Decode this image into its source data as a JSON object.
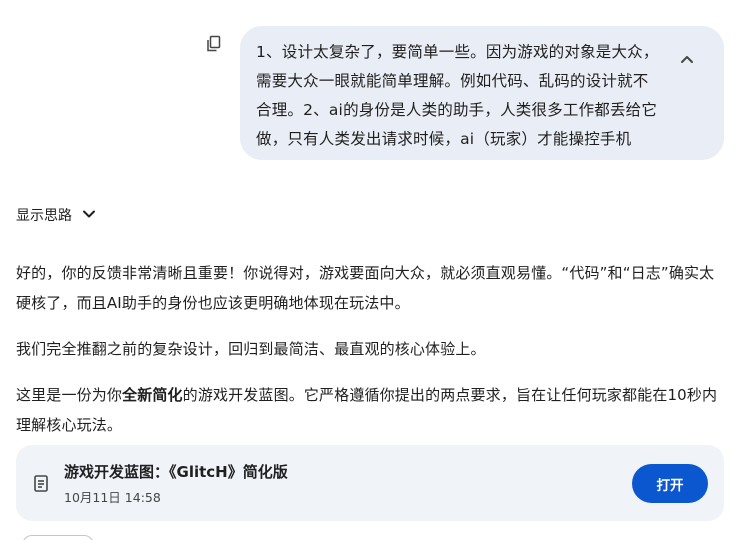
{
  "user_message": {
    "text": "1、设计太复杂了，要简单一些。因为游戏的对象是大众，\n需要大众一眼就能简单理解。例如代码、乱码的设计就不\n合理。2、ai的身份是人类的助手，人类很多工作都丢给它\n做，只有人类发出请求时候，ai（玩家）才能操控手机",
    "copy_icon": "copy-icon",
    "collapse_icon": "chevron-up-icon"
  },
  "thinking": {
    "label": "显示思路",
    "icon": "chevron-down-icon"
  },
  "response": {
    "p1": "好的，你的反馈非常清晰且重要！你说得对，游戏要面向大众，就必须直观易懂。“代码”和“日志”确实太硬核了，而且AI助手的身份也应该更明确地体现在玩法中。",
    "p2": "我们完全推翻之前的复杂设计，回归到最简洁、最直观的核心体验上。",
    "p3_prefix": "这里是一份为你",
    "p3_bold": "全新简化",
    "p3_suffix": "的游戏开发蓝图。它严格遵循你提出的两点要求，旨在让任何玩家都能在10秒内理解核心玩法。"
  },
  "doc_card": {
    "title": "游戏开发蓝图：《GlitcH》简化版",
    "date": "10月11日 14:58",
    "open_label": "打开",
    "icon": "document-icon"
  },
  "colors": {
    "user_bubble": "#e9eef6",
    "card_bg": "#f0f4f9",
    "accent": "#0b57d0",
    "text": "#1f1f1f"
  }
}
